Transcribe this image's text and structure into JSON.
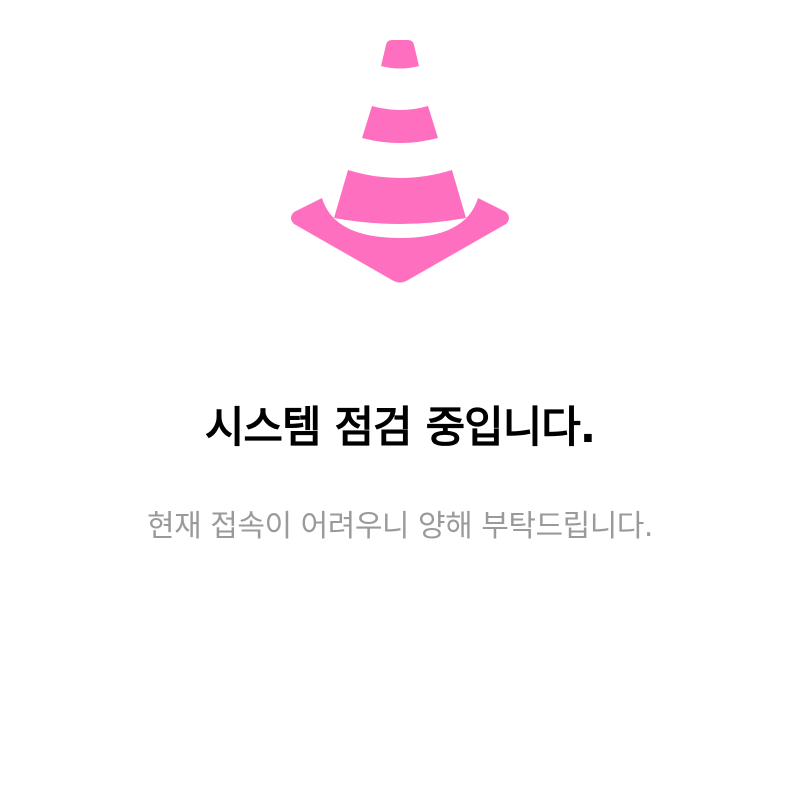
{
  "maintenance": {
    "icon": "traffic-cone-icon",
    "accent_color": "#ff6fbf",
    "title": "시스템 점검 중입니다.",
    "message": "현재 접속이 어려우니 양해 부탁드립니다."
  }
}
